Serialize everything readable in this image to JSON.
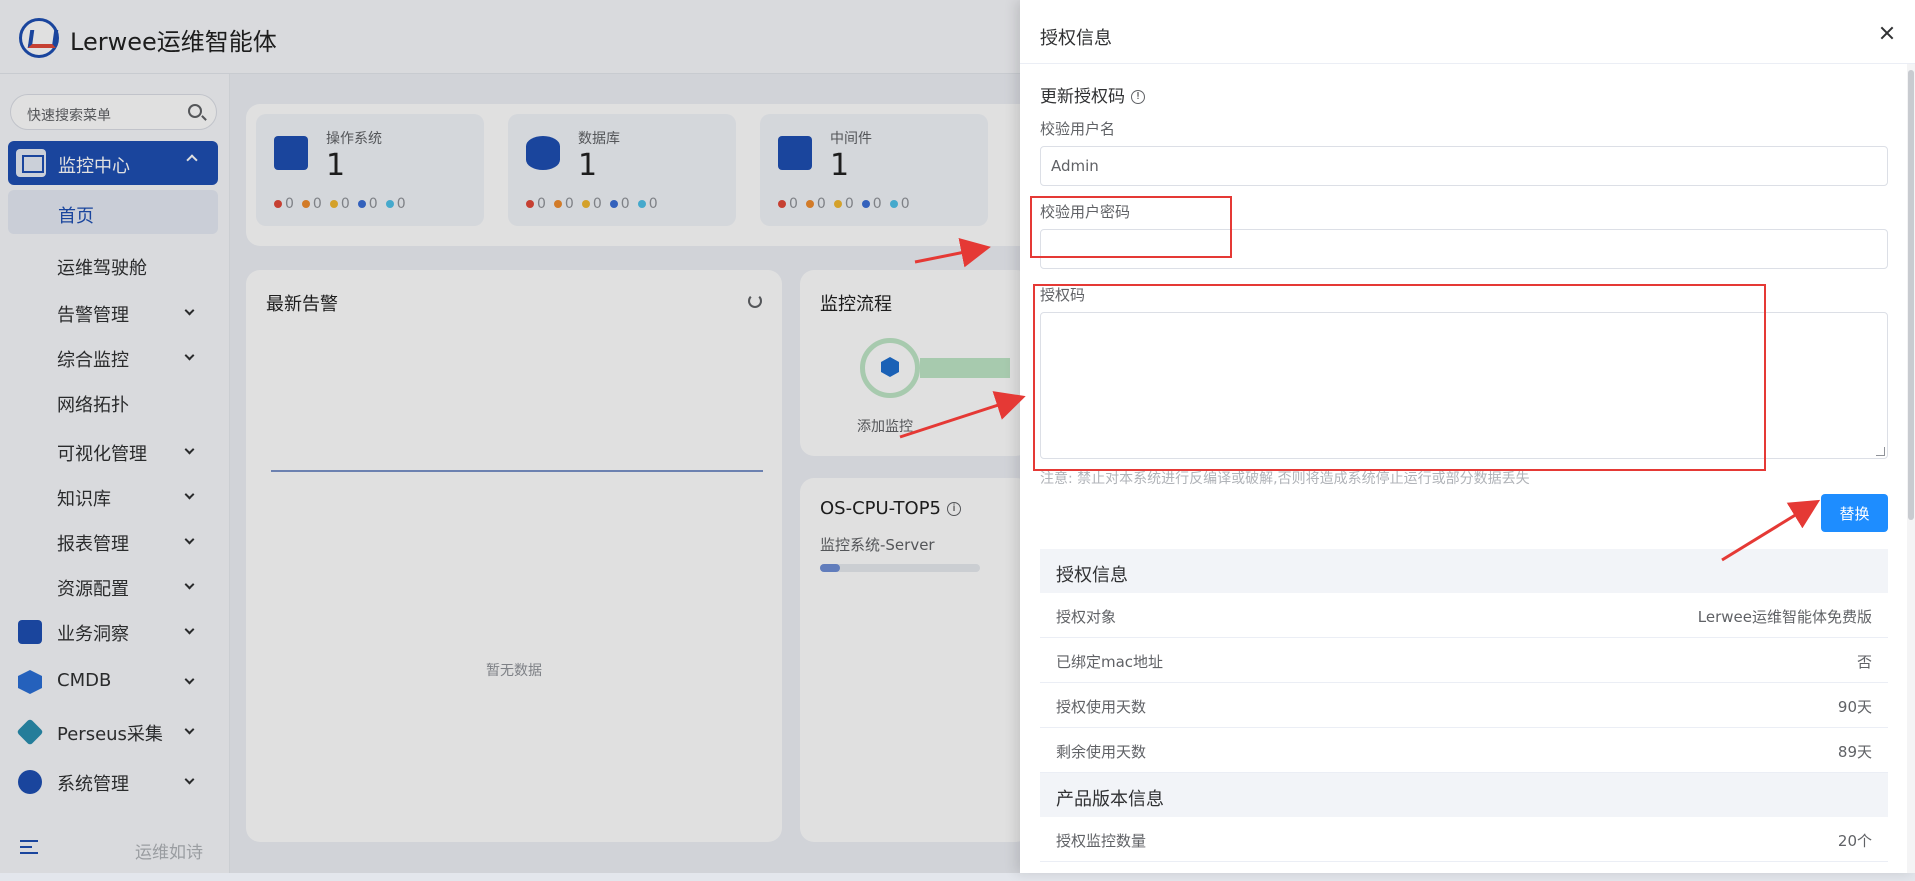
{
  "app": {
    "brand": "Lerwee运维智能体"
  },
  "sidebar": {
    "search_placeholder": "快速搜索菜单",
    "active_group": "监控中心",
    "home": "首页",
    "items": [
      "运维驾驶舱",
      "告警管理",
      "综合监控",
      "网络拓扑",
      "可视化管理",
      "知识库",
      "报表管理",
      "资源配置"
    ],
    "groups": [
      "业务洞察",
      "CMDB",
      "Perseus采集",
      "系统管理"
    ],
    "footer_text": "运维如诗"
  },
  "stats": [
    {
      "label": "操作系统",
      "value": "1",
      "counts": [
        "0",
        "0",
        "0",
        "0",
        "0"
      ]
    },
    {
      "label": "数据库",
      "value": "1",
      "counts": [
        "0",
        "0",
        "0",
        "0",
        "0"
      ]
    },
    {
      "label": "中间件",
      "value": "1",
      "counts": [
        "0",
        "0",
        "0",
        "0",
        "0"
      ]
    }
  ],
  "status_colors": [
    "#e2493a",
    "#f08c2e",
    "#f2b830",
    "#3b6fd6",
    "#4fc1e9"
  ],
  "panels": {
    "alerts_title": "最新告警",
    "alerts_empty": "暂无数据",
    "flow_title": "监控流程",
    "flow_step": "添加监控",
    "cpu_title": "OS-CPU-TOP5",
    "cpu_sub": "监控系统-Server"
  },
  "drawer": {
    "title": "授权信息",
    "section_title": "更新授权码",
    "username_label": "校验用户名",
    "username_value": "Admin",
    "password_label": "校验用户密码",
    "password_value": "",
    "code_label": "授权码",
    "code_value": "",
    "notice": "注意: 禁止对本系统进行反编译或破解,否则将造成系统停止运行或部分数据丢失",
    "replace_button": "替换",
    "license_header": "授权信息",
    "license_rows": [
      {
        "k": "授权对象",
        "v": "Lerwee运维智能体免费版"
      },
      {
        "k": "已绑定mac地址",
        "v": "否"
      },
      {
        "k": "授权使用天数",
        "v": "90天"
      },
      {
        "k": "剩余使用天数",
        "v": "89天"
      }
    ],
    "version_header": "产品版本信息",
    "version_rows": [
      {
        "k": "授权监控数量",
        "v": "20个"
      }
    ]
  },
  "annotation_color": "#e53935"
}
